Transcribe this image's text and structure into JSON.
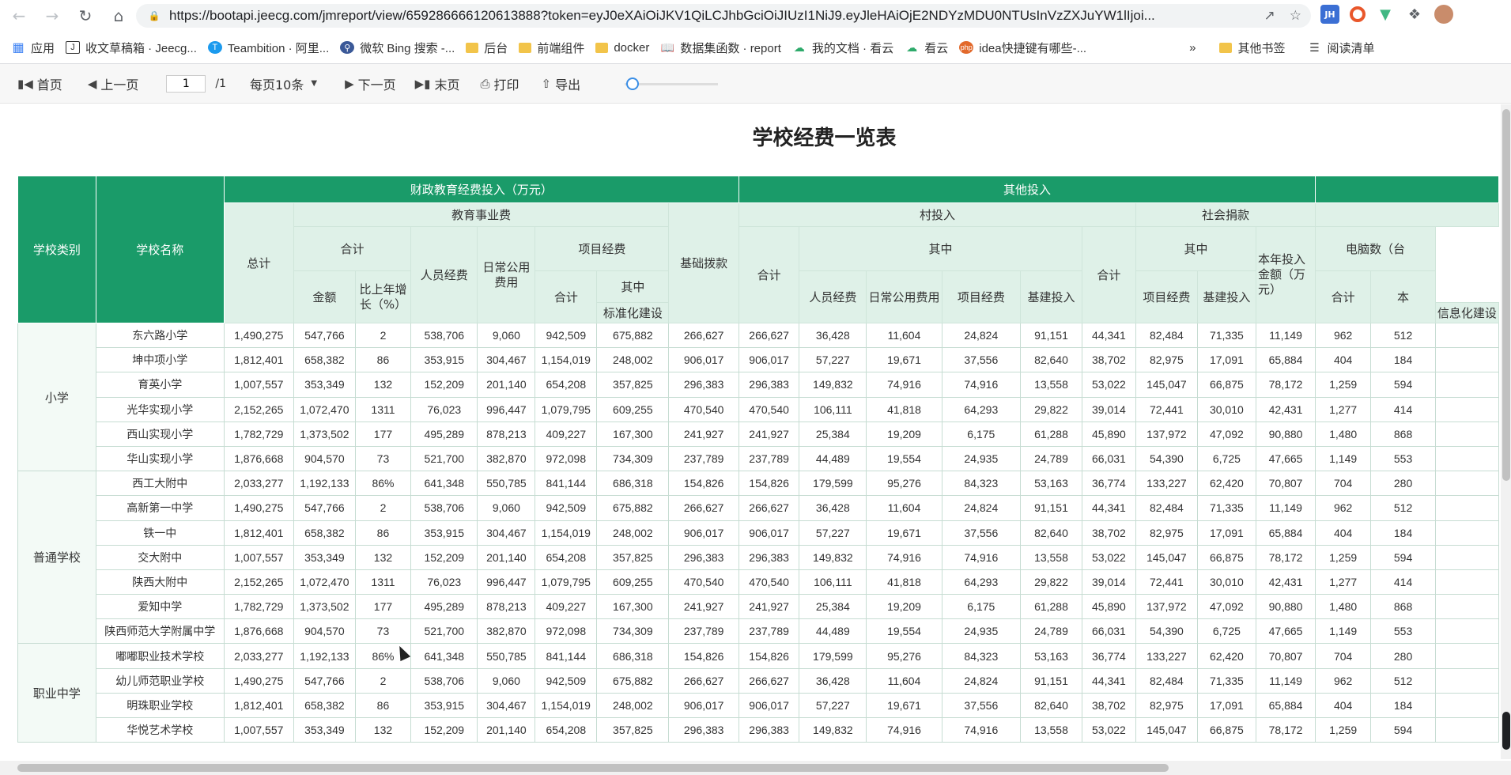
{
  "browser": {
    "url": "https://bootapi.jeecg.com/jmreport/view/659286666120613888?token=eyJ0eXAiOiJKV1QiLCJhbGciOiJIUzI1NiJ9.eyJleHAiOjE2NDYzMDU0NTUsInVzZXJuYW1lIjoi...",
    "extensions": [
      "JH",
      "chrome-ext",
      "vue-ext",
      "puzzle-icon",
      "avatar"
    ],
    "bookmarks": [
      {
        "label": "应用",
        "icon": "apps-grid-icon"
      },
      {
        "label": "收文草稿箱 · Jeecg...",
        "icon": "jeecg-icon"
      },
      {
        "label": "Teambition · 阿里...",
        "icon": "teambition-icon"
      },
      {
        "label": "微软 Bing 搜索 -...",
        "icon": "bing-icon"
      },
      {
        "label": "后台",
        "icon": "folder-icon"
      },
      {
        "label": "前端组件",
        "icon": "folder-icon"
      },
      {
        "label": "docker",
        "icon": "folder-icon"
      },
      {
        "label": "数据集函数 · report",
        "icon": "book-icon"
      },
      {
        "label": "我的文档 · 看云",
        "icon": "kancloud-icon"
      },
      {
        "label": "看云",
        "icon": "kancloud-icon"
      },
      {
        "label": "idea快捷键有哪些-...",
        "icon": "php-icon"
      }
    ],
    "bookmarks_right": [
      {
        "label": "其他书签",
        "icon": "folder-icon"
      },
      {
        "label": "阅读清单",
        "icon": "reading-list-icon"
      }
    ],
    "overflow_label": "»"
  },
  "toolbar": {
    "first": "首页",
    "prev": "上一页",
    "page_value": "1",
    "page_total": "/1",
    "page_size": "每页10条",
    "next": "下一页",
    "last": "末页",
    "print": "打印",
    "export": "导出",
    "zoom_level": 0.1
  },
  "report": {
    "title": "学校经费一览表",
    "headers": {
      "category": "学校类别",
      "name": "学校名称",
      "fiscal": "财政教育经费投入（万元）",
      "other": "其他投入",
      "total": "总计",
      "edu": "教育事业费",
      "basic": "基础拨款",
      "sum": "合计",
      "amount": "金额",
      "growth": "比上年增长（%）",
      "staff": "人员经费",
      "daily": "日常公用费用",
      "project": "项目经费",
      "among": "其中",
      "standard": "标准化建设",
      "info": "信息化建设",
      "village": "村投入",
      "v_sum": "合计",
      "v_among": "其中",
      "v_staff": "人员经费",
      "v_daily": "日常公用费用",
      "v_project": "项目经费",
      "v_build": "基建投入",
      "social": "社会捐款",
      "s_sum": "合计",
      "s_among": "其中",
      "s_project": "项目经费",
      "s_build": "基建投入",
      "year_invest": "本年投入金额（万元）",
      "pc": "电脑数（台",
      "pc_sum": "合计",
      "pc_this": "本"
    },
    "groups": [
      {
        "category": "小学",
        "rows": [
          [
            "东六路小学",
            "1,490,275",
            "547,766",
            "2",
            "538,706",
            "9,060",
            "942,509",
            "675,882",
            "266,627",
            "266,627",
            "36,428",
            "11,604",
            "24,824",
            "91,151",
            "44,341",
            "82,484",
            "71,335",
            "11,149",
            "962",
            "512"
          ],
          [
            "坤中项小学",
            "1,812,401",
            "658,382",
            "86",
            "353,915",
            "304,467",
            "1,154,019",
            "248,002",
            "906,017",
            "906,017",
            "57,227",
            "19,671",
            "37,556",
            "82,640",
            "38,702",
            "82,975",
            "17,091",
            "65,884",
            "404",
            "184"
          ],
          [
            "育英小学",
            "1,007,557",
            "353,349",
            "132",
            "152,209",
            "201,140",
            "654,208",
            "357,825",
            "296,383",
            "296,383",
            "149,832",
            "74,916",
            "74,916",
            "13,558",
            "53,022",
            "145,047",
            "66,875",
            "78,172",
            "1,259",
            "594"
          ],
          [
            "光华实现小学",
            "2,152,265",
            "1,072,470",
            "1311",
            "76,023",
            "996,447",
            "1,079,795",
            "609,255",
            "470,540",
            "470,540",
            "106,111",
            "41,818",
            "64,293",
            "29,822",
            "39,014",
            "72,441",
            "30,010",
            "42,431",
            "1,277",
            "414"
          ],
          [
            "西山实现小学",
            "1,782,729",
            "1,373,502",
            "177",
            "495,289",
            "878,213",
            "409,227",
            "167,300",
            "241,927",
            "241,927",
            "25,384",
            "19,209",
            "6,175",
            "61,288",
            "45,890",
            "137,972",
            "47,092",
            "90,880",
            "1,480",
            "868"
          ],
          [
            "华山实现小学",
            "1,876,668",
            "904,570",
            "73",
            "521,700",
            "382,870",
            "972,098",
            "734,309",
            "237,789",
            "237,789",
            "44,489",
            "19,554",
            "24,935",
            "24,789",
            "66,031",
            "54,390",
            "6,725",
            "47,665",
            "1,149",
            "553"
          ]
        ]
      },
      {
        "category": "普通学校",
        "rows": [
          [
            "西工大附中",
            "2,033,277",
            "1,192,133",
            "86%",
            "641,348",
            "550,785",
            "841,144",
            "686,318",
            "154,826",
            "154,826",
            "179,599",
            "95,276",
            "84,323",
            "53,163",
            "36,774",
            "133,227",
            "62,420",
            "70,807",
            "704",
            "280"
          ],
          [
            "高新第一中学",
            "1,490,275",
            "547,766",
            "2",
            "538,706",
            "9,060",
            "942,509",
            "675,882",
            "266,627",
            "266,627",
            "36,428",
            "11,604",
            "24,824",
            "91,151",
            "44,341",
            "82,484",
            "71,335",
            "11,149",
            "962",
            "512"
          ],
          [
            "铁一中",
            "1,812,401",
            "658,382",
            "86",
            "353,915",
            "304,467",
            "1,154,019",
            "248,002",
            "906,017",
            "906,017",
            "57,227",
            "19,671",
            "37,556",
            "82,640",
            "38,702",
            "82,975",
            "17,091",
            "65,884",
            "404",
            "184"
          ],
          [
            "交大附中",
            "1,007,557",
            "353,349",
            "132",
            "152,209",
            "201,140",
            "654,208",
            "357,825",
            "296,383",
            "296,383",
            "149,832",
            "74,916",
            "74,916",
            "13,558",
            "53,022",
            "145,047",
            "66,875",
            "78,172",
            "1,259",
            "594"
          ],
          [
            "陕西大附中",
            "2,152,265",
            "1,072,470",
            "1311",
            "76,023",
            "996,447",
            "1,079,795",
            "609,255",
            "470,540",
            "470,540",
            "106,111",
            "41,818",
            "64,293",
            "29,822",
            "39,014",
            "72,441",
            "30,010",
            "42,431",
            "1,277",
            "414"
          ],
          [
            "爱知中学",
            "1,782,729",
            "1,373,502",
            "177",
            "495,289",
            "878,213",
            "409,227",
            "167,300",
            "241,927",
            "241,927",
            "25,384",
            "19,209",
            "6,175",
            "61,288",
            "45,890",
            "137,972",
            "47,092",
            "90,880",
            "1,480",
            "868"
          ],
          [
            "陕西师范大学附属中学",
            "1,876,668",
            "904,570",
            "73",
            "521,700",
            "382,870",
            "972,098",
            "734,309",
            "237,789",
            "237,789",
            "44,489",
            "19,554",
            "24,935",
            "24,789",
            "66,031",
            "54,390",
            "6,725",
            "47,665",
            "1,149",
            "553"
          ]
        ]
      },
      {
        "category": "职业中学",
        "rows": [
          [
            "嘟嘟职业技术学校",
            "2,033,277",
            "1,192,133",
            "86%",
            "641,348",
            "550,785",
            "841,144",
            "686,318",
            "154,826",
            "154,826",
            "179,599",
            "95,276",
            "84,323",
            "53,163",
            "36,774",
            "133,227",
            "62,420",
            "70,807",
            "704",
            "280"
          ],
          [
            "幼儿师范职业学校",
            "1,490,275",
            "547,766",
            "2",
            "538,706",
            "9,060",
            "942,509",
            "675,882",
            "266,627",
            "266,627",
            "36,428",
            "11,604",
            "24,824",
            "91,151",
            "44,341",
            "82,484",
            "71,335",
            "11,149",
            "962",
            "512"
          ],
          [
            "明珠职业学校",
            "1,812,401",
            "658,382",
            "86",
            "353,915",
            "304,467",
            "1,154,019",
            "248,002",
            "906,017",
            "906,017",
            "57,227",
            "19,671",
            "37,556",
            "82,640",
            "38,702",
            "82,975",
            "17,091",
            "65,884",
            "404",
            "184"
          ],
          [
            "华悦艺术学校",
            "1,007,557",
            "353,349",
            "132",
            "152,209",
            "201,140",
            "654,208",
            "357,825",
            "296,383",
            "296,383",
            "149,832",
            "74,916",
            "74,916",
            "13,558",
            "53,022",
            "145,047",
            "66,875",
            "78,172",
            "1,259",
            "594"
          ]
        ]
      }
    ]
  }
}
